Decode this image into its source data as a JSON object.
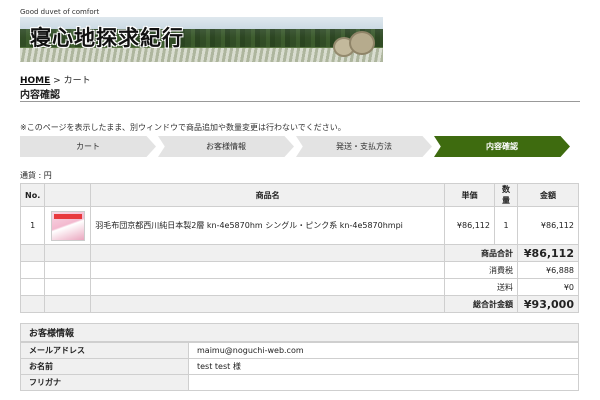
{
  "header": {
    "tagline": "Good duvet of comfort",
    "logo_text": "寝心地探求紀行"
  },
  "breadcrumb": {
    "home": "HOME",
    "separator": " > ",
    "current": "カート"
  },
  "page_title": "内容確認",
  "notice": "※このページを表示したまま、別ウィンドウで商品追加や数量変更は行わないでください。",
  "steps": [
    {
      "label": "カート"
    },
    {
      "label": "お客様情報"
    },
    {
      "label": "発送・支払方法"
    },
    {
      "label": "内容確認"
    }
  ],
  "currency_note": "通貨 : 円",
  "items_table": {
    "headers": {
      "no": "No.",
      "name": "商品名",
      "price": "単価",
      "qty": "数量",
      "amount": "金額"
    },
    "rows": [
      {
        "no": "1",
        "name": "羽毛布団京都西川純日本製2層 kn-4e5870hm シングル・ピンク系 kn-4e5870hmpi",
        "price": "¥86,112",
        "qty": "1",
        "amount": "¥86,112"
      }
    ]
  },
  "totals": {
    "subtotal_label": "商品合計",
    "subtotal": "¥86,112",
    "tax_label": "消費税",
    "tax": "¥6,888",
    "shipping_label": "送料",
    "shipping": "¥0",
    "total_label": "総合計金額",
    "total": "¥93,000"
  },
  "customer": {
    "section_title": "お客様情報",
    "fields": [
      {
        "label": "メールアドレス",
        "value": "maimu@noguchi-web.com"
      },
      {
        "label": "お名前",
        "value": "test test 様"
      },
      {
        "label": "フリガナ",
        "value": ""
      }
    ]
  },
  "colors": {
    "active_step": "#3e6b0f",
    "table_header_bg": "#f0f0f0"
  }
}
